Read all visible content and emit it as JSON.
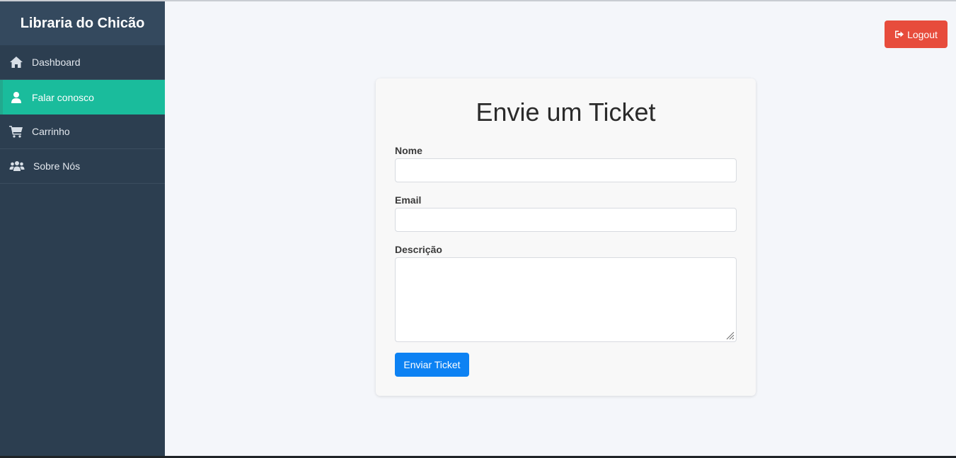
{
  "brand": {
    "title": "Libraria do Chicão"
  },
  "sidebar": {
    "items": [
      {
        "label": "Dashboard",
        "icon": "home-icon",
        "active": false
      },
      {
        "label": "Falar conosco",
        "icon": "user-icon",
        "active": true
      },
      {
        "label": "Carrinho",
        "icon": "cart-icon",
        "active": false
      },
      {
        "label": "Sobre Nós",
        "icon": "users-icon",
        "active": false
      }
    ]
  },
  "header": {
    "logout_label": "Logout",
    "logout_icon": "sign-out-icon"
  },
  "form": {
    "title": "Envie um Ticket",
    "name_label": "Nome",
    "name_value": "",
    "email_label": "Email",
    "email_value": "",
    "description_label": "Descrição",
    "description_value": "",
    "submit_label": "Enviar Ticket"
  },
  "colors": {
    "sidebar": "#2c3e50",
    "brand_bg": "#34495e",
    "active": "#1abc9c",
    "logout": "#e74c3c",
    "submit": "#0d82f3"
  }
}
